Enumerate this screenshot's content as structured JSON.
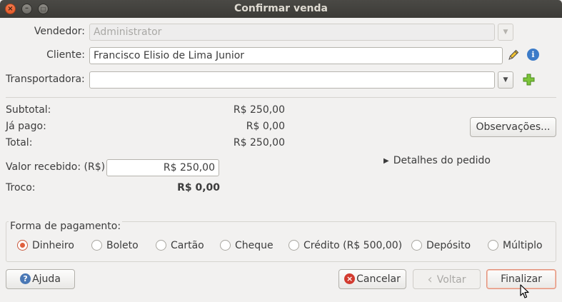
{
  "window": {
    "title": "Confirmar venda",
    "close_glyph": "×",
    "min_glyph": "–",
    "max_glyph": "□"
  },
  "form": {
    "vendedor_label": "Vendedor:",
    "vendedor_value": "Administrator",
    "cliente_label": "Cliente:",
    "cliente_value": "Francisco Elisio de Lima Junior",
    "transportadora_label": "Transportadora:",
    "transportadora_value": ""
  },
  "totals": {
    "subtotal_label": "Subtotal:",
    "subtotal_value": "R$ 250,00",
    "ja_pago_label": "Já pago:",
    "ja_pago_value": "R$ 0,00",
    "total_label": "Total:",
    "total_value": "R$ 250,00",
    "valor_recebido_label": "Valor recebido: (R$)",
    "valor_recebido_value": "R$ 250,00",
    "troco_label": "Troco:",
    "troco_value": "R$ 0,00"
  },
  "side": {
    "observacoes_label": "Observações...",
    "detalhes_label": "Detalhes do pedido",
    "detalhes_arrow": "▶"
  },
  "payment": {
    "frame_title": "Forma de pagamento:",
    "options": [
      {
        "label": "Dinheiro",
        "selected": true
      },
      {
        "label": "Boleto",
        "selected": false
      },
      {
        "label": "Cartão",
        "selected": false
      },
      {
        "label": "Cheque",
        "selected": false
      },
      {
        "label": "Crédito (R$ 500,00)",
        "selected": false
      },
      {
        "label": "Depósito",
        "selected": false
      },
      {
        "label": "Múltiplo",
        "selected": false
      }
    ]
  },
  "buttons": {
    "ajuda": "Ajuda",
    "cancelar": "Cancelar",
    "voltar": "Voltar",
    "finalizar": "Finalizar"
  },
  "icons": {
    "dropdown_arrow": "▼",
    "help_glyph": "?",
    "cancel_glyph": "×",
    "info_glyph": "i",
    "back_glyph": "‹"
  },
  "colors": {
    "accent_orange": "#e0603e",
    "add_green": "#6bb42e",
    "info_blue": "#3c7bc8",
    "cancel_red": "#d23b2f",
    "help_blue": "#4a78b5"
  }
}
